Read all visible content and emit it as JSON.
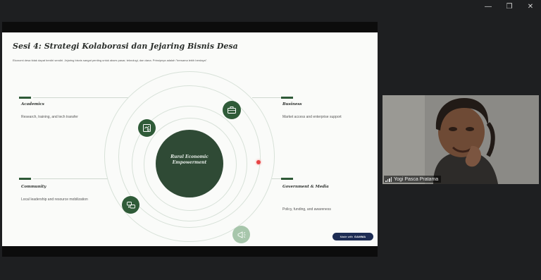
{
  "window": {
    "minimize_glyph": "—",
    "restore_glyph": "❐",
    "close_glyph": "✕"
  },
  "slide": {
    "title": "Sesi 4: Strategi Kolaborasi dan Jejaring Bisnis Desa",
    "subtitle": "Ekonomi desa tidak dapat berdiri sendiri. Jejaring bisnis sangat penting untuk akses pasar, teknologi, dan dana. Prinsipnya adalah \"bersama lebih berdaya\".",
    "center_label_line1": "Rural Economic",
    "center_label_line2": "Empowerment",
    "nodes": {
      "academics": {
        "title": "Academics",
        "desc": "Research, training, and tech transfer"
      },
      "business": {
        "title": "Business",
        "desc": "Market access and enterprise support"
      },
      "community": {
        "title": "Community",
        "desc": "Local leadership and resource mobilization"
      },
      "government": {
        "title": "Government & Media",
        "desc": "Policy, funding, and awareness"
      }
    },
    "badge": {
      "prefix": "Made with",
      "brand": "GAMMA"
    }
  },
  "participant": {
    "name": "Yogi Pasca Pratama"
  },
  "colors": {
    "accent": "#2f5b38",
    "core": "#2f4a35",
    "slide_bg": "#fafbf9"
  }
}
